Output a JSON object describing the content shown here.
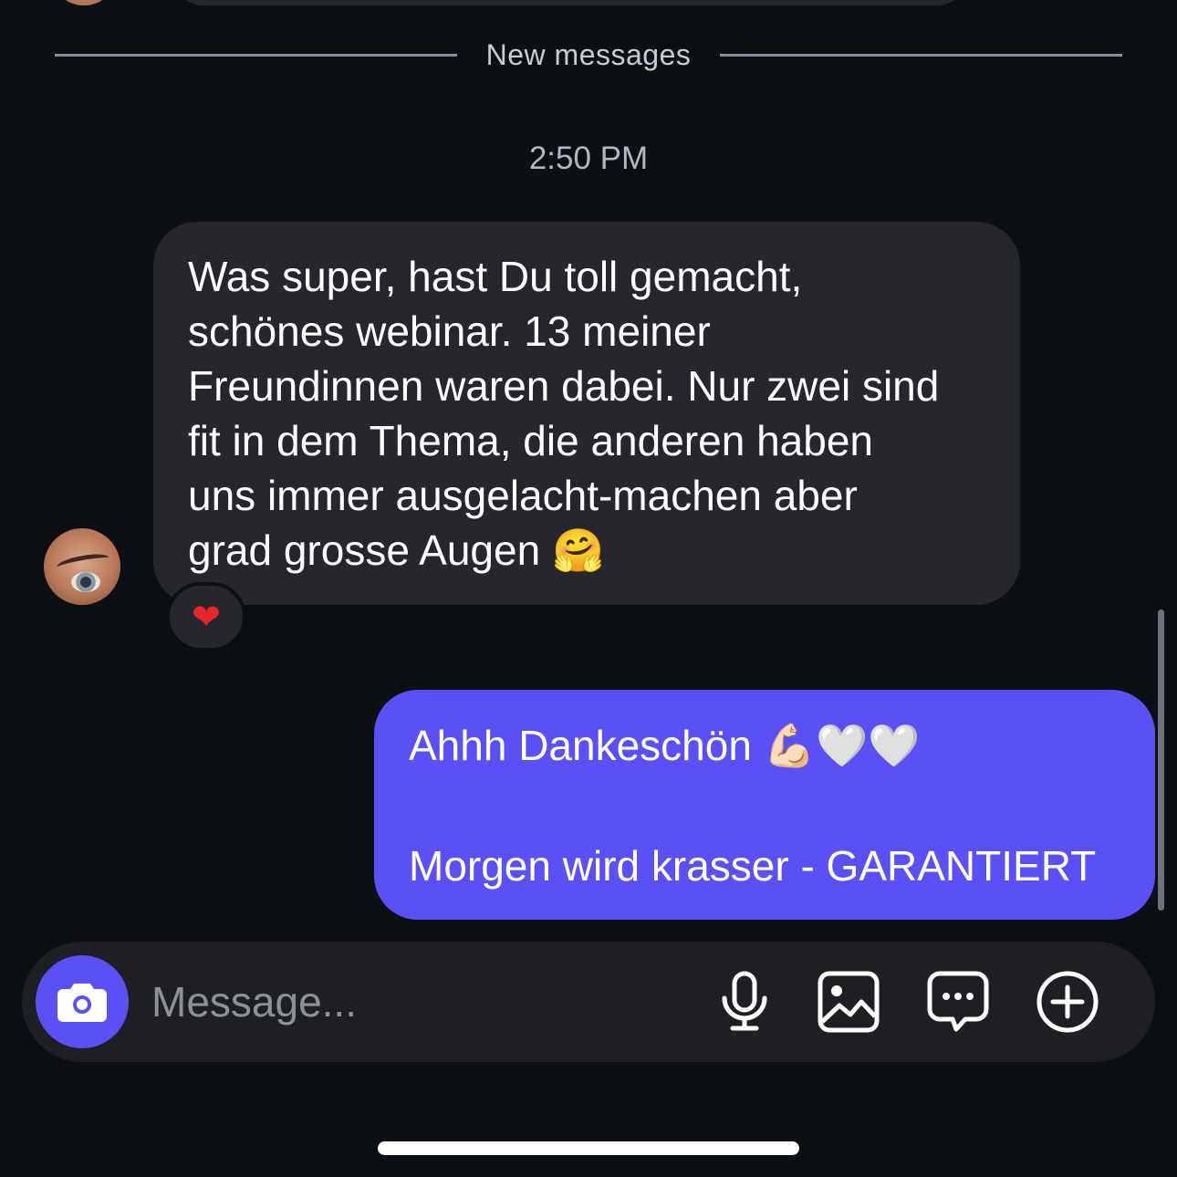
{
  "divider": {
    "label": "New messages"
  },
  "timestamp": "2:50 PM",
  "incoming_message": {
    "text": "Was super, hast Du toll gemacht,\nschönes webinar. 13 meiner\nFreundinnen waren dabei. Nur zwei sind\nfit in dem Thema, die anderen haben\nuns immer ausgelacht-machen aber\ngrad grosse Augen 🤗",
    "reaction": "❤"
  },
  "outgoing_message": {
    "line1": "Ahhh Dankeschön 💪🏻🤍🤍",
    "line2": "Morgen wird krasser - GARANTIERT"
  },
  "composer": {
    "placeholder": "Message...",
    "icons": {
      "camera": "camera-icon",
      "mic": "microphone-icon",
      "gallery": "image-icon",
      "sticker": "chat-bubble-icon",
      "plus": "plus-circle-icon"
    }
  },
  "colors": {
    "background": "#0c0f14",
    "incoming_bubble": "#25272c",
    "outgoing_bubble": "#5a50f5",
    "accent": "#5a50f5"
  }
}
